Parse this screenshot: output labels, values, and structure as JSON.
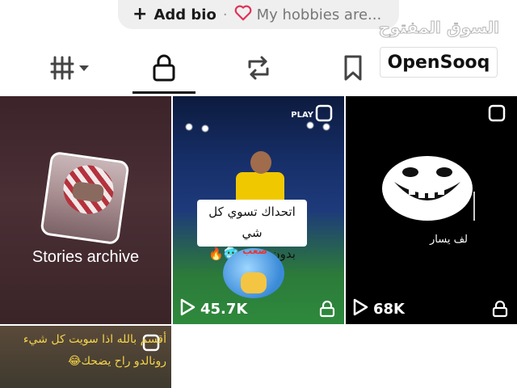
{
  "bio": {
    "add_label": "Add bio",
    "separator": "·",
    "hobbies_label": "My hobbies are..."
  },
  "watermark": {
    "arabic": "السوق المفتوح",
    "brand": "OpenSooq"
  },
  "tabs": [
    {
      "name": "tab-videos",
      "icon": "grid-bars-icon"
    },
    {
      "name": "tab-private",
      "icon": "lock-icon",
      "active": true
    },
    {
      "name": "tab-reposts",
      "icon": "repost-icon"
    },
    {
      "name": "tab-saved",
      "icon": "bookmark-icon"
    }
  ],
  "grid": {
    "archive": {
      "label": "Stories archive"
    },
    "video1": {
      "play_label": "PLAY",
      "card_line1": "اتحداك تسوي كل شي",
      "card_line2": "بدون تنفس🥶🔥",
      "emoji_text": "صعب",
      "views": "45.7K"
    },
    "video2": {
      "caption": "لف يسار",
      "views": "68K"
    },
    "video3": {
      "line1": "أقسم بالله اذا سويت كل شيء",
      "line2": "رونالدو راح يضحك😂"
    }
  },
  "colors": {
    "accent_heart": "#e0325a",
    "active_underline": "#111111"
  }
}
